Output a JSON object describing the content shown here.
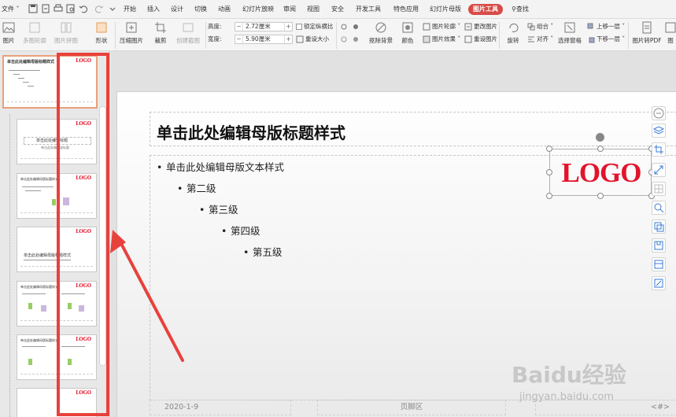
{
  "menu": {
    "file": "文件",
    "tabs": [
      "开始",
      "插入",
      "设计",
      "切换",
      "动画",
      "幻灯片放映",
      "审阅",
      "视图",
      "安全",
      "开发工具",
      "特色应用",
      "幻灯片母版",
      "图片工具"
    ],
    "active_tab": "图片工具",
    "search": "查找"
  },
  "ribbon": {
    "insert_picture": "图片",
    "multi_outline": "多图轮廓",
    "picture_combine": "图片拼图",
    "shape": "形状",
    "compress": "压缩图片",
    "crop": "裁剪",
    "create_video": "创建截图",
    "height_label": "高度:",
    "height_value": "2.72厘米",
    "width_label": "宽度:",
    "width_value": "5.90厘米",
    "lock_ratio": "锁定纵横比",
    "reset_size": "重设大小",
    "remove_bg": "抠除背景",
    "color": "颜色",
    "outline": "图片轮廓",
    "effects": "图片效果",
    "change_picture": "更改图片",
    "reset_picture": "重设图片",
    "rotate": "旋转",
    "group": "组合",
    "align": "对齐",
    "select_pane": "选择窗格",
    "bring_forward": "上移一层",
    "send_backward": "下移一层",
    "to_pdf": "图片转PDF",
    "to_text": "图"
  },
  "thumbnails": [
    {
      "type": "master",
      "logo": "LOGO",
      "title": "单击此处编辑母版标题样式"
    },
    {
      "type": "title",
      "logo": "LOGO",
      "title": "单击此处编辑标题",
      "subtitle": "单击此处编辑副标题"
    },
    {
      "type": "content",
      "logo": "LOGO",
      "title": "单击此处编辑母版标题样式"
    },
    {
      "type": "section",
      "logo": "LOGO",
      "title": "单击此处编辑母版标题样式"
    },
    {
      "type": "two",
      "logo": "LOGO",
      "title": "单击此处编辑母版标题样式"
    },
    {
      "type": "compare",
      "logo": "LOGO",
      "title": "单击此处编辑母版标题样式"
    },
    {
      "type": "blank",
      "logo": "LOGO"
    }
  ],
  "slide": {
    "title": "单击此处编辑母版标题样式",
    "levels": [
      "单击此处编辑母版文本样式",
      "第二级",
      "第三级",
      "第四级",
      "第五级"
    ],
    "logo": "LOGO",
    "footer_date": "2020-1-9",
    "footer_text": "页脚区",
    "footer_num": "<#>"
  },
  "watermark": {
    "brand": "Baidu经验",
    "url": "jingyan.baidu.com"
  },
  "colors": {
    "logo_red": "#e2142b",
    "annotation_red": "#e8413c",
    "active_tab_bg": "#d74b47"
  }
}
